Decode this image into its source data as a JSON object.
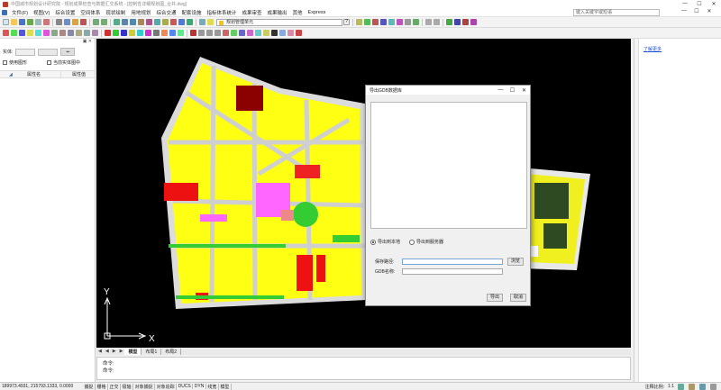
{
  "window": {
    "title": "中国城市规划设计研究院 - 规划成果检查与数据汇交系统 - [控制性详细规划图_合并.dwg]",
    "controls": [
      "—",
      "☐",
      "✕"
    ]
  },
  "menu": {
    "items": [
      "文件(F)",
      "视图(V)",
      "综合设置",
      "空间体系",
      "现状绘制",
      "用地规划",
      "综合交通",
      "配套设施",
      "指标体系统计",
      "成果审查",
      "成果输出",
      "其他",
      "Express"
    ],
    "help_placeholder": "键入关键字或短语",
    "controls": [
      "—",
      "☐",
      "✕"
    ]
  },
  "toolbar": {
    "layer_name": "规划管理单元",
    "help": "?"
  },
  "left_panel": {
    "header_left": "",
    "header_controls": "▣ ✕",
    "entity_label": "实体:",
    "checkbox1": "使用图形",
    "checkbox2": "当前实体图中",
    "col_name": "属性名",
    "col_value": "属性值"
  },
  "canvas": {
    "axis_y": "Y",
    "axis_x": "X"
  },
  "tabs": {
    "nav": [
      "◀",
      "◀",
      "▶",
      "▶"
    ],
    "items": [
      "模型",
      "布局1",
      "布局2"
    ]
  },
  "command": {
    "line1": "命令:",
    "line2": "命令:"
  },
  "status": {
    "coords": "189973.4931, 215793.1333, 0.0000",
    "toggles": [
      "捕捉",
      "栅格",
      "正交",
      "极轴",
      "对象捕捉",
      "对象追踪",
      "DUCS",
      "DYN",
      "线宽",
      "模型"
    ],
    "annotation_scale_label": "注释比例:",
    "annotation_scale": "1:1"
  },
  "right_panel": {
    "link": "了解更多"
  },
  "dialog": {
    "title": "导出GDB数据库",
    "controls": [
      "—",
      "☐",
      "✕"
    ],
    "radio1": "导出到本地",
    "radio2": "导出到服务器",
    "field1_label": "保存路径:",
    "field2_label": "GDB名称:",
    "browse": "浏览",
    "ok": "导出",
    "cancel": "取消"
  }
}
